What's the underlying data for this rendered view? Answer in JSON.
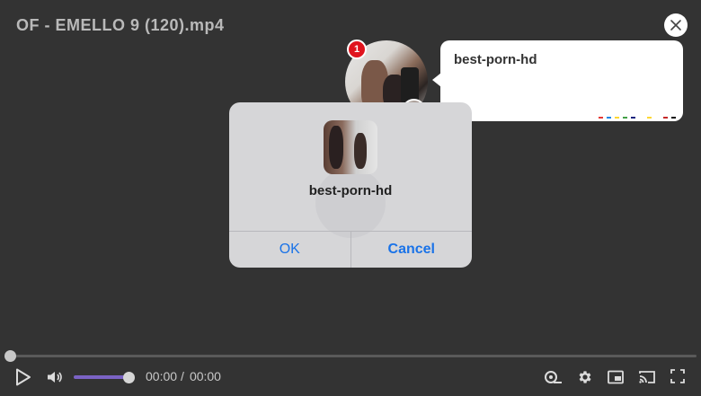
{
  "player": {
    "title": "OF - EMELLO 9 (120).mp4",
    "time_current": "00:00",
    "time_separator": "/",
    "time_total": "00:00",
    "volume_level": 1.0,
    "progress": 0.0
  },
  "notification": {
    "badge_count": "1",
    "sender": "best-porn-hd",
    "dot_colors": [
      "#e53935",
      "#1e88e5",
      "#fdd835",
      "#43a047",
      "#1a237e",
      "#ffffff",
      "#fdd835",
      "#ffffff",
      "#c62828",
      "#111111"
    ]
  },
  "dialog": {
    "title": "best-porn-hd",
    "ok_label": "OK",
    "cancel_label": "Cancel"
  },
  "icons": {
    "close": "close-icon",
    "play": "play-icon",
    "volume": "volume-icon",
    "speed": "playback-speed-icon",
    "settings": "gear-icon",
    "pip": "picture-in-picture-icon",
    "cast": "cast-icon",
    "fullscreen": "fullscreen-icon"
  },
  "colors": {
    "background": "#333333",
    "accent": "#7b63c5",
    "link": "#1a73e8",
    "badge": "#e0141e"
  }
}
